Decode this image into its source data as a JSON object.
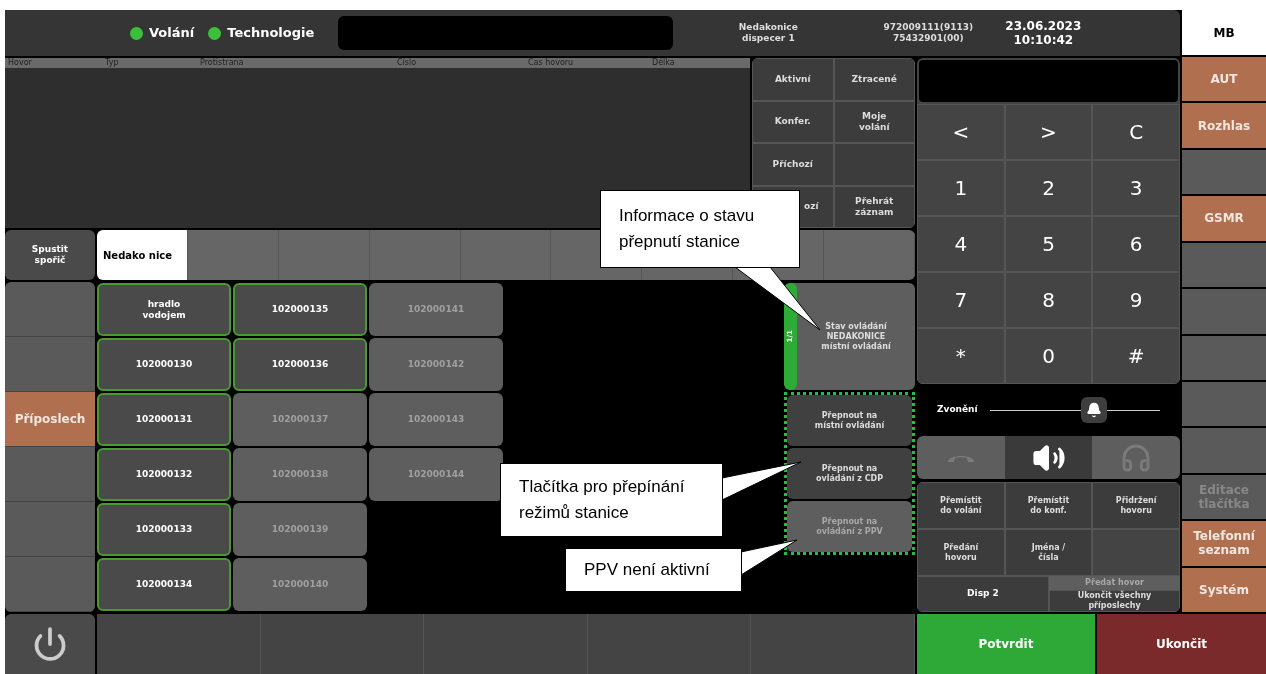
{
  "top_bar": {
    "indicators": [
      {
        "label": "Volání",
        "color": "#3cc03c"
      },
      {
        "label": "Technologie",
        "color": "#3cc03c"
      }
    ],
    "station": "Nedakonice\ndispecer 1",
    "numbers": "972009111(9113)\n75432901(00)",
    "date": "23.06.2023",
    "time": "10:10:42"
  },
  "call_table": {
    "columns": [
      "Hovor",
      "Typ",
      "Protistrana",
      "Číslo",
      "Čas hovoru",
      "Délka"
    ]
  },
  "filters": [
    {
      "kind": "text",
      "label": "Aktivní"
    },
    {
      "kind": "text",
      "label": "Ztracené"
    },
    {
      "kind": "text",
      "label": "Konfer."
    },
    {
      "kind": "text",
      "label": "Moje\nvolání"
    },
    {
      "kind": "text",
      "label": "Příchozí"
    },
    {
      "kind": "blank"
    },
    {
      "kind": "covered",
      "label": "ozí"
    },
    {
      "kind": "text",
      "label": "Přehrát\nzáznam"
    }
  ],
  "screensaver_button": "Spustit\nspořič",
  "tabs": [
    {
      "label": "Nedako nice",
      "selected": true
    },
    {
      "selected": false
    },
    {
      "selected": false
    },
    {
      "selected": false
    },
    {
      "selected": false
    },
    {
      "selected": false
    },
    {
      "selected": false
    },
    {
      "selected": false
    },
    {
      "selected": false
    }
  ],
  "left_buttons": [
    {
      "highlighted": false
    },
    {
      "highlighted": false
    },
    {
      "label": "Příposlech",
      "highlighted": true
    },
    {
      "highlighted": false
    },
    {
      "highlighted": false
    },
    {
      "highlighted": false
    }
  ],
  "grid_columns": [
    [
      {
        "label": "hradlo\nvodojem",
        "active": true
      },
      {
        "label": "102000130",
        "active": true
      },
      {
        "label": "102000131",
        "active": true
      },
      {
        "label": "102000132",
        "active": true
      },
      {
        "label": "102000133",
        "active": true
      },
      {
        "label": "102000134",
        "active": true
      }
    ],
    [
      {
        "label": "102000135",
        "active": true
      },
      {
        "label": "102000136",
        "active": true
      },
      {
        "label": "102000137",
        "active": false
      },
      {
        "label": "102000138",
        "active": false
      },
      {
        "label": "102000139",
        "active": false
      },
      {
        "label": "102000140",
        "active": false
      }
    ],
    [
      {
        "label": "102000141",
        "active": false
      },
      {
        "label": "102000142",
        "active": false
      },
      {
        "label": "102000143",
        "active": false
      },
      {
        "label": "102000144",
        "active": false
      }
    ]
  ],
  "station_status": {
    "page": "1/1",
    "text": "Stav ovládání\nNEDAKONICE\nmístní ovládání"
  },
  "mode_buttons": [
    {
      "label": "Přepnout na\nmístní ovládání",
      "disabled": false
    },
    {
      "label": "Přepnout na\novládání z CDP",
      "disabled": false
    },
    {
      "label": "Přepnout na\novládání z PPV",
      "disabled": true
    }
  ],
  "keypad": [
    "<",
    ">",
    "C",
    "1",
    "2",
    "3",
    "4",
    "5",
    "6",
    "7",
    "8",
    "9",
    "*",
    "0",
    "#"
  ],
  "ringer": {
    "label": "Zvonění",
    "level": 0.61
  },
  "audio_modes": [
    {
      "kind": "handset",
      "selected": false
    },
    {
      "kind": "speaker",
      "selected": true
    },
    {
      "kind": "headset",
      "selected": false
    }
  ],
  "actions": [
    {
      "kind": "text",
      "label": "Přemístit\ndo volání"
    },
    {
      "kind": "text",
      "label": "Přemístit\ndo konf."
    },
    {
      "kind": "text",
      "label": "Přidržení\nhovoru"
    },
    {
      "kind": "text",
      "label": "Předání\nhovoru"
    },
    {
      "kind": "text",
      "label": "Jména /\nčísla"
    },
    {
      "kind": "blank"
    }
  ],
  "disp_button": "Disp 2",
  "handover_button": {
    "label": "Předat hovor",
    "disabled": true
  },
  "end_monitoring_button": "Ukončit všechny\npříposlechy",
  "confirm_button": "Potvrdit",
  "end_button": "Ukončit",
  "sidebar": [
    {
      "label": "MB",
      "kind": "selected"
    },
    {
      "label": "AUT",
      "kind": "accent"
    },
    {
      "label": "Rozhlas",
      "kind": "accent"
    },
    {
      "kind": "plain"
    },
    {
      "label": "GSMR",
      "kind": "accent"
    },
    {
      "kind": "plain"
    },
    {
      "kind": "plain"
    },
    {
      "kind": "plain"
    },
    {
      "kind": "plain"
    },
    {
      "kind": "plain"
    },
    {
      "label": "Editace\ntlačítka",
      "kind": "disabled"
    },
    {
      "label": "Telefonní\nseznam",
      "kind": "accent"
    },
    {
      "label": "Systém",
      "kind": "accent"
    }
  ],
  "callouts": [
    {
      "text": "Informace o stavu\npřepnutí stanice"
    },
    {
      "text": "Tlačítka pro přepínání\nrežimů stanice"
    },
    {
      "text": "PPV není aktivní"
    }
  ]
}
